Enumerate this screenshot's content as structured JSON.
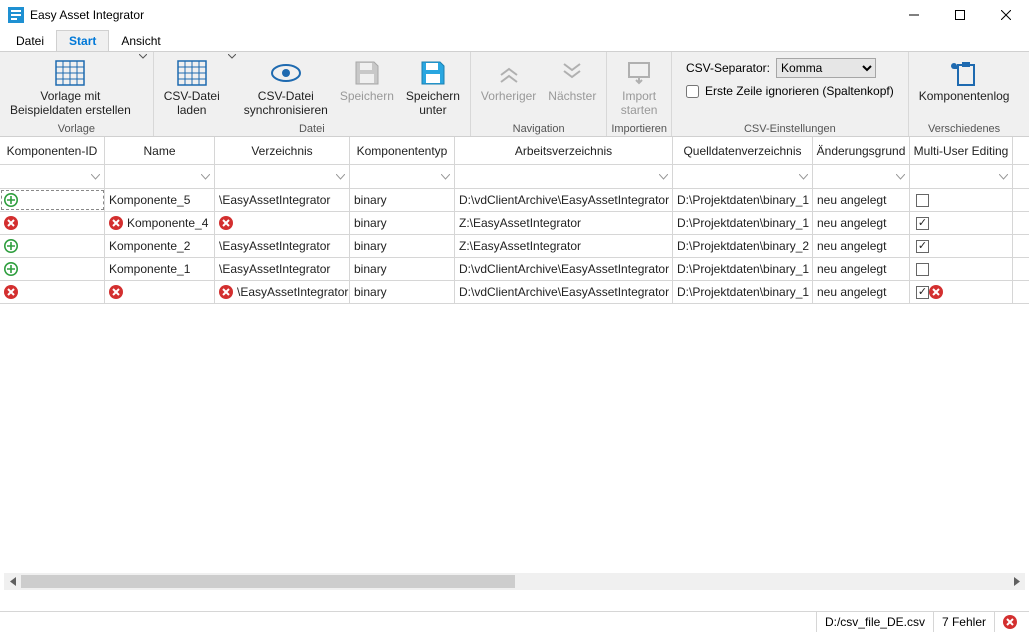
{
  "app": {
    "title": "Easy Asset Integrator"
  },
  "menu": {
    "datei": "Datei",
    "start": "Start",
    "ansicht": "Ansicht"
  },
  "ribbon": {
    "vorlage_group": "Vorlage",
    "vorlage_btn": "Vorlage mit\nBeispieldaten erstellen",
    "datei_group": "Datei",
    "csv_laden": "CSV-Datei\nladen",
    "csv_sync": "CSV-Datei\nsynchronisieren",
    "speichern": "Speichern",
    "speichern_unter": "Speichern\nunter",
    "nav_group": "Navigation",
    "vorheriger": "Vorheriger",
    "naechster": "Nächster",
    "import_group": "Importieren",
    "import_starten": "Import\nstarten",
    "csv_group": "CSV-Einstellungen",
    "csv_separator_label": "CSV-Separator:",
    "csv_separator_value": "Komma",
    "csv_first_line": "Erste Zeile ignorieren (Spaltenkopf)",
    "versch_group": "Verschiedenes",
    "komp_log": "Komponentenlog"
  },
  "grid": {
    "headers": {
      "komponenten_id": "Komponenten-ID",
      "name": "Name",
      "verzeichnis": "Verzeichnis",
      "komponententyp": "Komponententyp",
      "arbeitsverzeichnis": "Arbeitsverzeichnis",
      "quelldaten": "Quelldatenverzeichnis",
      "aenderungsgrund": "Änderungsgrund",
      "multiuser": "Multi-User Editing"
    },
    "rows": [
      {
        "id_icon": "plus",
        "name_err": false,
        "name": "Komponente_5",
        "verz_err": false,
        "verz": "\\EasyAssetIntegrator",
        "typ": "binary",
        "arb": "D:\\vdClientArchive\\EasyAssetIntegrator",
        "quell": "D:\\Projektdaten\\binary_1",
        "grund": "neu angelegt",
        "mu": false,
        "row_err": false,
        "selected": true
      },
      {
        "id_icon": "error",
        "name_err": true,
        "name": "Komponente_4",
        "verz_err": true,
        "verz": "",
        "typ": "binary",
        "arb": "Z:\\EasyAssetIntegrator",
        "quell": "D:\\Projektdaten\\binary_1",
        "grund": "neu angelegt",
        "mu": true,
        "row_err": false
      },
      {
        "id_icon": "plus",
        "name_err": false,
        "name": "Komponente_2",
        "verz_err": false,
        "verz": "\\EasyAssetIntegrator",
        "typ": "binary",
        "arb": "Z:\\EasyAssetIntegrator",
        "quell": "D:\\Projektdaten\\binary_2",
        "grund": "neu angelegt",
        "mu": true,
        "row_err": false
      },
      {
        "id_icon": "plus",
        "name_err": false,
        "name": "Komponente_1",
        "verz_err": false,
        "verz": "\\EasyAssetIntegrator",
        "typ": "binary",
        "arb": "D:\\vdClientArchive\\EasyAssetIntegrator",
        "quell": "D:\\Projektdaten\\binary_1",
        "grund": "neu angelegt",
        "mu": false,
        "row_err": false
      },
      {
        "id_icon": "error",
        "name_err": true,
        "name": "",
        "verz_err": true,
        "verz": "\\EasyAssetIntegrator",
        "typ": "binary",
        "arb": "D:\\vdClientArchive\\EasyAssetIntegrator",
        "quell": "D:\\Projektdaten\\binary_1",
        "grund": "neu angelegt",
        "mu": true,
        "row_err": true
      }
    ]
  },
  "status": {
    "file": "D:/csv_file_DE.csv",
    "errors": "7 Fehler"
  }
}
